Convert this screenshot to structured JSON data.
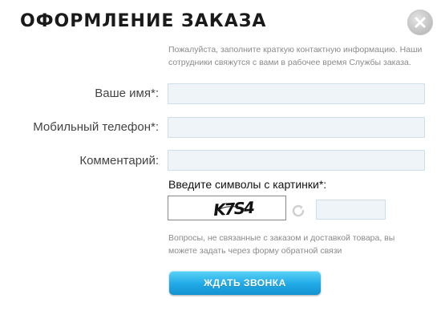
{
  "dialog": {
    "title": "ОФОРМЛЕНИЕ ЗАКАЗА",
    "close_icon": "close-icon",
    "intro": "Пожалуйста, заполните краткую контактную информацию. Наши сотрудники свяжутся с вами в рабочее время Службы заказа."
  },
  "form": {
    "name_label": "Ваше имя*:",
    "name_value": "",
    "phone_label": "Мобильный телефон*:",
    "phone_value": "",
    "comment_label": "Комментарий:",
    "comment_value": "",
    "captcha_label": "Введите символы с картинки*:",
    "captcha_text": "K7S4",
    "refresh_icon": "refresh-icon",
    "captcha_value": ""
  },
  "note": "Вопросы, не связанные с заказом и доставкой товара, вы можете задать через форму обратной связи",
  "submit_label": "ЖДАТЬ ЗВОНКА",
  "colors": {
    "button": "#1fa9e6",
    "field_bg": "#eef4f7",
    "close_bg": "#c4c4c4"
  }
}
